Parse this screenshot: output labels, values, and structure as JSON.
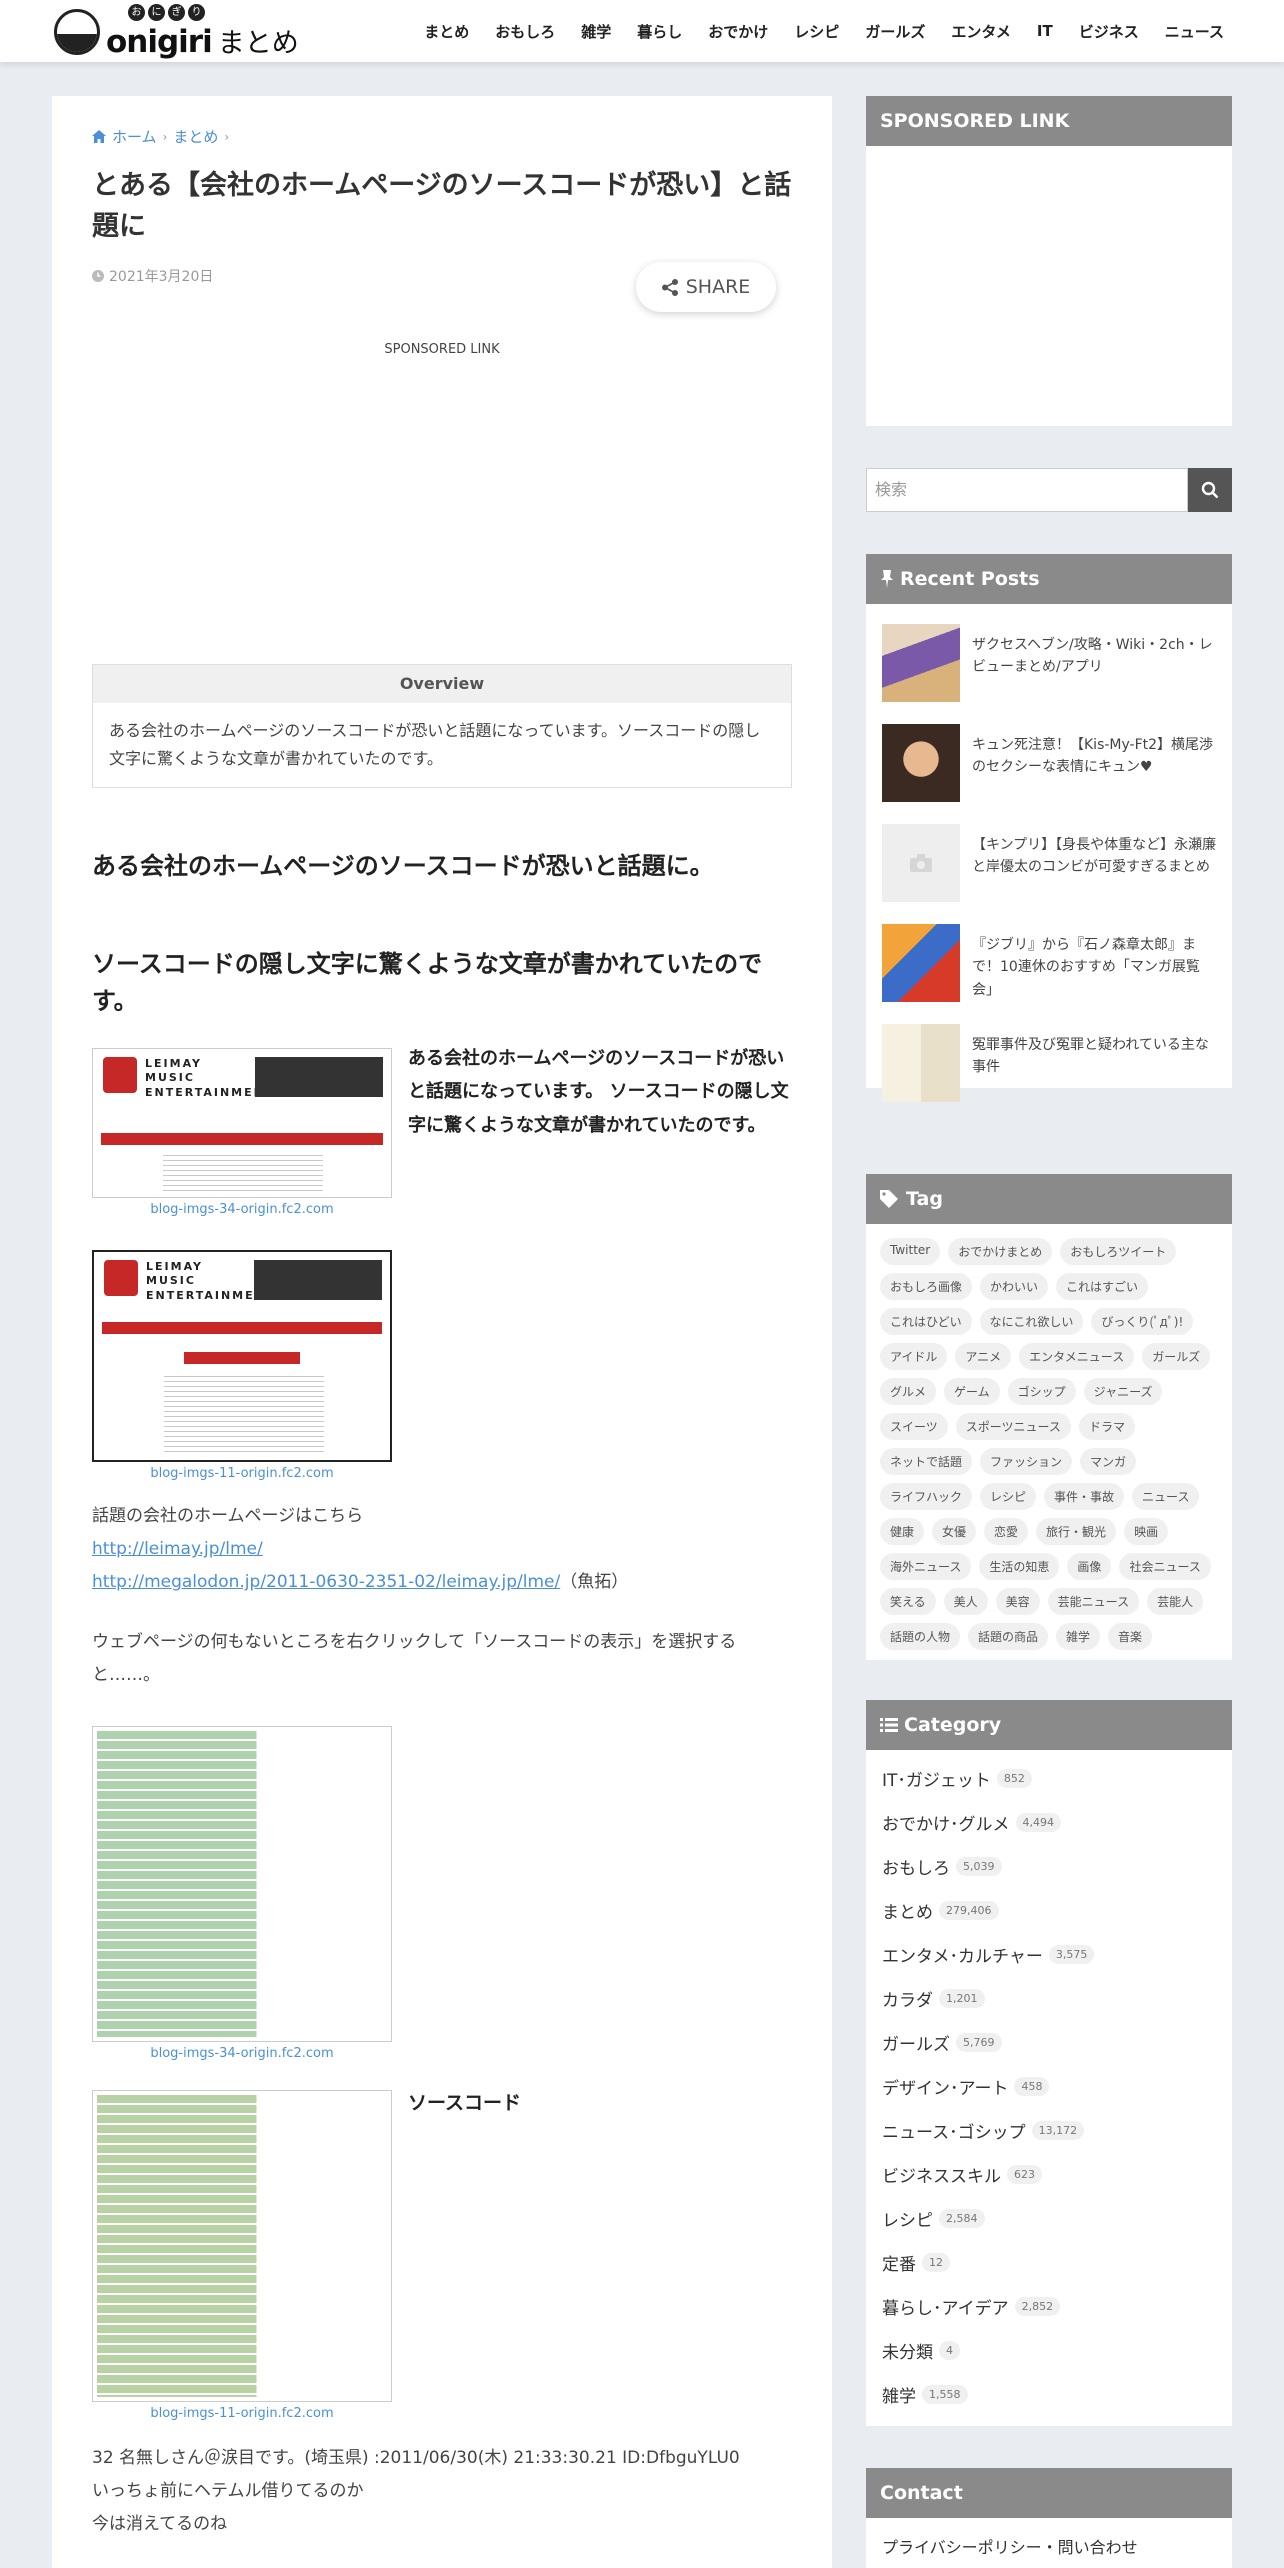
{
  "header": {
    "logo_rubi": [
      "お",
      "に",
      "ぎ",
      "り"
    ],
    "logo_en": "onigiri",
    "logo_jp": "まとめ",
    "nav": [
      "まとめ",
      "おもしろ",
      "雑学",
      "暮らし",
      "おでかけ",
      "レシピ",
      "ガールズ",
      "エンタメ",
      "IT",
      "ビジネス",
      "ニュース"
    ]
  },
  "article": {
    "breadcrumb": [
      "ホーム",
      "まとめ"
    ],
    "title": "とある【会社のホームページのソースコードが恐い】と話題に",
    "date": "2021年3月20日",
    "share_label": "SHARE",
    "sponsored_label": "SPONSORED LINK",
    "overview_heading": "Overview",
    "overview_text": "ある会社のホームページのソースコードが恐いと話題になっています。ソースコードの隠し文字に驚くような文章が書かれていたのです。",
    "h2_1": "ある会社のホームページのソースコードが恐いと話題に。",
    "h2_2": "ソースコードの隠し文字に驚くような文章が書かれていたのです。",
    "lead": "ある会社のホームページのソースコードが恐いと話題になっています。 ソースコードの隠し文字に驚くような文章が書かれていたのです。",
    "captions": [
      "blog-imgs-34-origin.fc2.com",
      "blog-imgs-11-origin.fc2.com",
      "blog-imgs-34-origin.fc2.com",
      "blog-imgs-11-origin.fc2.com"
    ],
    "site_brand": "LEIMAY MUSIC ENTERTAINMENT",
    "p_company": "話題の会社のホームページはこちら",
    "link1": "http://leimay.jp/lme/",
    "link2": "http://megalodon.jp/2011-0630-2351-02/leimay.jp/lme/",
    "link2_note": "（魚拓）",
    "p_rightclick": "ウェブページの何もないところを右クリックして「ソースコードの表示」を選択すると……。",
    "source_label": "ソースコード",
    "comment1": "32 名無しさん＠涙目です。(埼玉県) :2011/06/30(木) 21:33:30.21 ID:DfbguYLU0",
    "comment2": "いっちょ前にヘテムル借りてるのか",
    "comment3": "今は消えてるのね"
  },
  "sidebar": {
    "sponsored_title": "SPONSORED LINK",
    "search_placeholder": "検索",
    "recent_title": "Recent Posts",
    "recent": [
      "ザクセスヘブン/攻略・Wiki・2ch・レビューまとめ/アプリ",
      "キュン死注意！【Kis-My-Ft2】横尾渉のセクシーな表情にキュン♥",
      "【キンプリ】【身長や体重など】永瀬廉と岸優太のコンビが可愛すぎるまとめ",
      "『ジブリ』から『石ノ森章太郎』まで！10連休のおすすめ「マンガ展覧会」",
      "冤罪事件及び冤罪と疑われている主な事件"
    ],
    "tag_title": "Tag",
    "tags": [
      "Twitter",
      "おでかけまとめ",
      "おもしろツイート",
      "おもしろ画像",
      "かわいい",
      "これはすごい",
      "これはひどい",
      "なにこれ欲しい",
      "びっくり(ﾟдﾟ)!",
      "アイドル",
      "アニメ",
      "エンタメニュース",
      "ガールズ",
      "グルメ",
      "ゲーム",
      "ゴシップ",
      "ジャニーズ",
      "スイーツ",
      "スポーツニュース",
      "ドラマ",
      "ネットで話題",
      "ファッション",
      "マンガ",
      "ライフハック",
      "レシピ",
      "事件・事故",
      "ニュース",
      "健康",
      "女優",
      "恋愛",
      "旅行・観光",
      "映画",
      "海外ニュース",
      "生活の知恵",
      "画像",
      "社会ニュース",
      "笑える",
      "美人",
      "美容",
      "芸能ニュース",
      "芸能人",
      "話題の人物",
      "話題の商品",
      "雑学",
      "音楽"
    ],
    "category_title": "Category",
    "categories": [
      {
        "name": "IT･ガジェット",
        "count": "852"
      },
      {
        "name": "おでかけ･グルメ",
        "count": "4,494"
      },
      {
        "name": "おもしろ",
        "count": "5,039"
      },
      {
        "name": "まとめ",
        "count": "279,406"
      },
      {
        "name": "エンタメ･カルチャー",
        "count": "3,575"
      },
      {
        "name": "カラダ",
        "count": "1,201"
      },
      {
        "name": "ガールズ",
        "count": "5,769"
      },
      {
        "name": "デザイン･アート",
        "count": "458"
      },
      {
        "name": "ニュース･ゴシップ",
        "count": "13,172"
      },
      {
        "name": "ビジネススキル",
        "count": "623"
      },
      {
        "name": "レシピ",
        "count": "2,584"
      },
      {
        "name": "定番",
        "count": "12"
      },
      {
        "name": "暮らし･アイデア",
        "count": "2,852"
      },
      {
        "name": "未分類",
        "count": "4"
      },
      {
        "name": "雑学",
        "count": "1,558"
      }
    ],
    "contact_title": "Contact",
    "contact_link": "プライバシーポリシー・問い合わせ"
  }
}
